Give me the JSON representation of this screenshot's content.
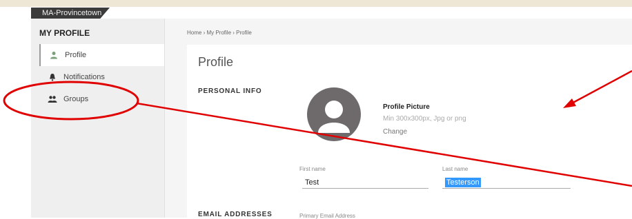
{
  "location": "MA-Provincetown",
  "sidebar": {
    "title": "MY PROFILE",
    "items": [
      {
        "label": "Profile",
        "icon": "person-icon"
      },
      {
        "label": "Notifications",
        "icon": "bell-icon"
      },
      {
        "label": "Groups",
        "icon": "groups-icon"
      }
    ]
  },
  "breadcrumb": "Home  ›  My Profile  ›  Profile",
  "page": {
    "title": "Profile",
    "personal_info_heading": "PERSONAL INFO",
    "profile_picture": {
      "label": "Profile Picture",
      "hint": "Min 300x300px, Jpg or png",
      "change": "Change"
    },
    "first_name": {
      "label": "First name",
      "value": "Test"
    },
    "last_name": {
      "label": "Last name",
      "value": "Testerson"
    },
    "email_heading": "EMAIL ADDRESSES",
    "primary_email_label": "Primary Email Address"
  },
  "colors": {
    "annotation": "#e00000",
    "selection": "#3399ff"
  }
}
